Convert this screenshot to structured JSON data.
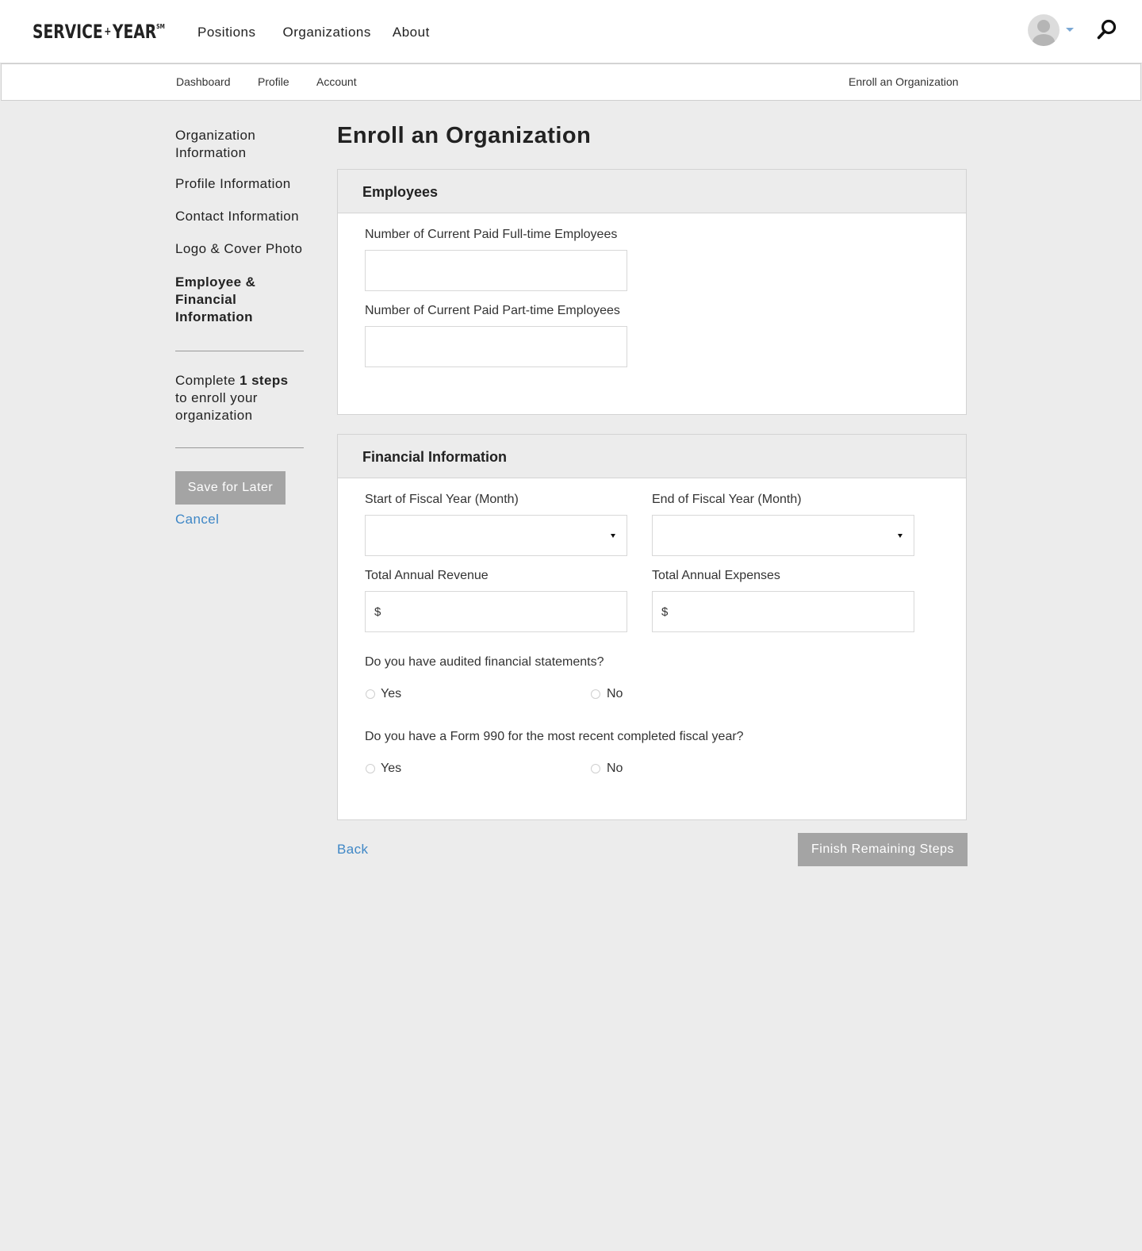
{
  "header": {
    "logo": {
      "word1": "SERVICE",
      "plus": "+",
      "word2": "YEAR",
      "mark": "SM"
    },
    "nav": [
      "Positions",
      "Organizations",
      "About"
    ],
    "icons": {
      "avatar": "user-avatar-icon",
      "caret": "chevron-down-icon",
      "search": "search-icon"
    },
    "caret_color": "#7aa7d4"
  },
  "subnav": {
    "items": [
      "Dashboard",
      "Profile",
      "Account"
    ],
    "right": "Enroll an Organization"
  },
  "sidebar": {
    "steps": [
      {
        "label": "Organization Information",
        "active": false
      },
      {
        "label": "Profile Information",
        "active": false
      },
      {
        "label": "Contact Information",
        "active": false
      },
      {
        "label": "Logo & Cover Photo",
        "active": false
      },
      {
        "label": "Employee & Financial Information",
        "active": true
      }
    ],
    "complete_prefix": "Complete",
    "complete_count": "1 steps",
    "complete_suffix": "to enroll your organization",
    "save_label": "Save for Later",
    "cancel_label": "Cancel"
  },
  "main": {
    "title": "Enroll an Organization",
    "employees": {
      "heading": "Employees",
      "fulltime_label": "Number of Current Paid Full-time Employees",
      "fulltime_value": "",
      "parttime_label": "Number of Current Paid Part-time Employees",
      "parttime_value": ""
    },
    "financial": {
      "heading": "Financial Information",
      "fy_start_label": "Start of Fiscal Year (Month)",
      "fy_start_value": "",
      "fy_end_label": "End of Fiscal Year (Month)",
      "fy_end_value": "",
      "revenue_label": "Total Annual Revenue",
      "revenue_prefix": "$",
      "expenses_label": "Total Annual Expenses",
      "expenses_prefix": "$",
      "audited_question": "Do you have audited financial statements?",
      "form990_question": "Do you have a Form 990 for the most recent completed fiscal year?",
      "yes_label": "Yes",
      "no_label": "No"
    },
    "back_label": "Back",
    "finish_label": "Finish Remaining Steps"
  },
  "colors": {
    "accent_link": "#3f87c6",
    "disabled_button": "#a4a4a4",
    "page_background": "#ececec"
  }
}
